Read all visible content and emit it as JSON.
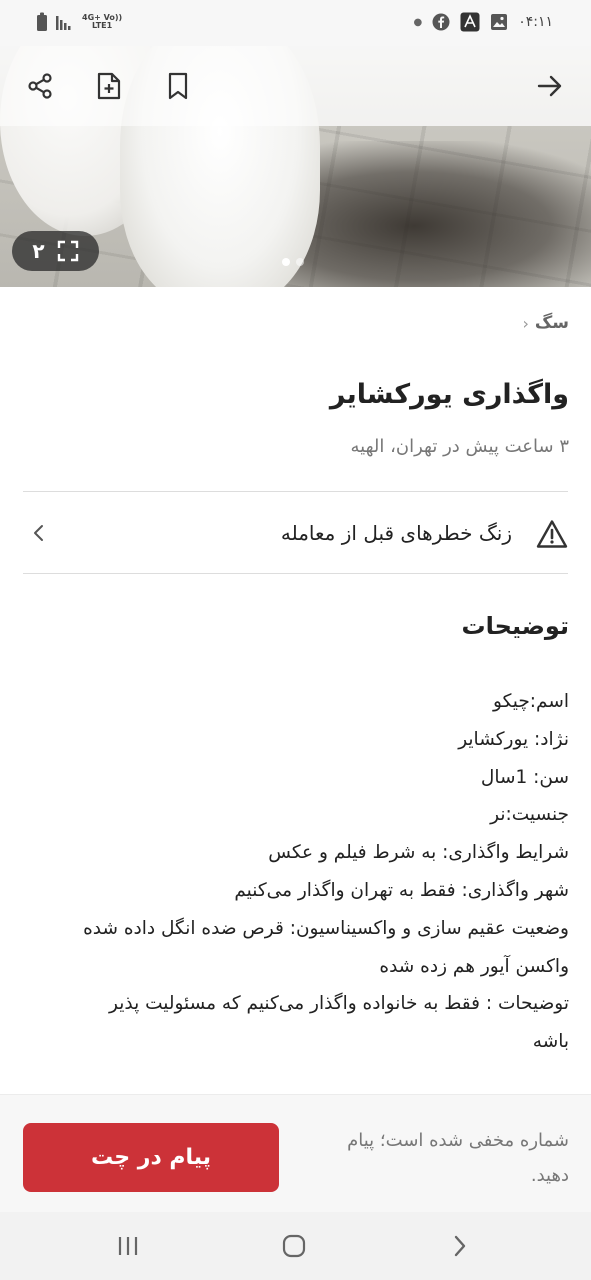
{
  "status_bar": {
    "time": "۰۴:۱۱",
    "network_top": "4G+ Vo))",
    "network_bottom": "LTE1"
  },
  "gallery": {
    "image_count": "۲",
    "active_dot": 1,
    "dot_count": 2
  },
  "breadcrumb": {
    "category": "سگ"
  },
  "listing": {
    "title": "واگذاری یورکشایر",
    "meta": "۳ ساعت پیش در تهران، الهیه"
  },
  "warning": {
    "label": "زنگ خطرهای قبل از معامله"
  },
  "description": {
    "heading": "توضیحات",
    "lines": [
      "اسم:چیکو",
      "نژاد: یورکشایر",
      "سن: 1سال",
      " جنسیت:نر",
      " شرایط واگذاری: به شرط فیلم و عکس",
      " شهر واگذاری: فقط به تهران واگذار می‌کنیم",
      "وضعیت عقیم سازی و واکسیناسیون: قرص ضده انگل داده شده",
      "واکسن آیور هم زده شده",
      "توضیحات : فقط به خانواده واگذار می‌کنیم که مسئولیت پذیر",
      "باشه"
    ]
  },
  "action_bar": {
    "chat_button": "پیام در چت",
    "hidden_note": "شماره مخفی شده است؛ پیام دهید."
  },
  "colors": {
    "accent": "#cc3238",
    "text_primary": "#222222",
    "text_secondary": "#777777"
  }
}
